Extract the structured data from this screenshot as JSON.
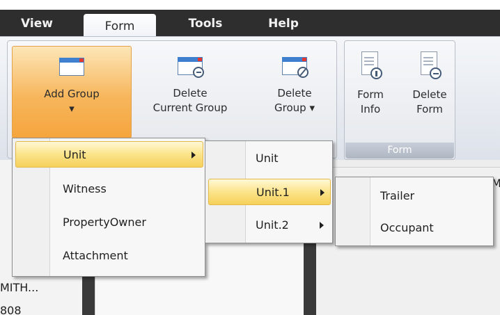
{
  "tabs": [
    {
      "label": "View"
    },
    {
      "label": "Form",
      "active": true
    },
    {
      "label": "Tools"
    },
    {
      "label": "Help"
    }
  ],
  "ribbon": {
    "add_group": "Add Group\n▾",
    "delete_current_group": "Delete\nCurrent Group",
    "delete_group": "Delete\nGroup ▾",
    "form_info": "Form\nInfo",
    "delete_form": "Delete\nForm",
    "form_group_caption": "Form"
  },
  "menu1": {
    "items": [
      {
        "label": "Unit",
        "submenu": true,
        "highlighted": true
      },
      {
        "label": "Witness"
      },
      {
        "label": "PropertyOwner"
      },
      {
        "label": "Attachment"
      }
    ]
  },
  "menu2": {
    "items": [
      {
        "label": "Unit"
      },
      {
        "label": "Unit.1",
        "submenu": true,
        "highlighted": true
      },
      {
        "label": "Unit.2",
        "submenu": true
      }
    ]
  },
  "menu3": {
    "items": [
      {
        "label": "Trailer"
      },
      {
        "label": "Occupant"
      }
    ]
  },
  "background": {
    "cell1": "MITH...",
    "cell2": "808",
    "right_edge": "M"
  },
  "colors": {
    "tab_bar": "#2e2e2e",
    "highlight": "#f6d05a",
    "hot_button": "#f5a53d"
  }
}
